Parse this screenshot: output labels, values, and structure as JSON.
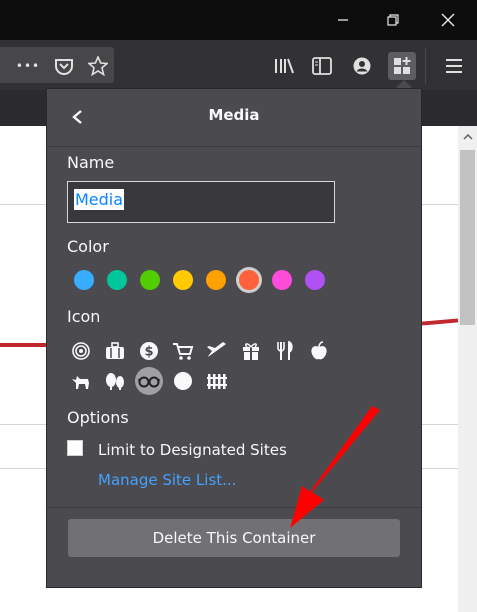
{
  "toolbar": {
    "icons": [
      "more-icon",
      "pocket-icon",
      "bookmark-star-icon",
      "library-icon",
      "sidebar-icon",
      "account-icon",
      "containers-icon",
      "menu-icon"
    ],
    "more_label": "•••"
  },
  "panel": {
    "title": "Media",
    "name_label": "Name",
    "name_value": "Media",
    "color_label": "Color",
    "colors": [
      "#37adff",
      "#00c79a",
      "#51cd00",
      "#ffcb00",
      "#ff9f00",
      "#ff613d",
      "#ff4bda",
      "#af51f5"
    ],
    "selected_color_index": 5,
    "icon_label": "Icon",
    "icons": [
      "fingerprint-icon",
      "briefcase-icon",
      "dollar-icon",
      "cart-icon",
      "airplane-icon",
      "gift-icon",
      "food-icon",
      "fruit-icon",
      "pet-icon",
      "tree-icon",
      "chill-icon",
      "circle-icon",
      "fence-icon"
    ],
    "selected_icon_index": 10,
    "options_label": "Options",
    "limit_label": "Limit to Designated Sites",
    "manage_link": "Manage Site List...",
    "delete_label": "Delete This Container"
  },
  "colors": {
    "panel_bg": "#4a4a4f",
    "link": "#45a1ff",
    "annotation_arrow": "#ff0000"
  }
}
